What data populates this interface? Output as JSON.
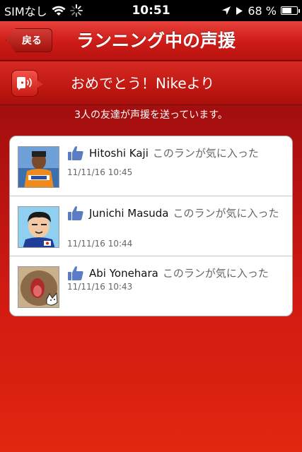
{
  "status_bar": {
    "carrier": "SIMなし",
    "time": "10:51",
    "battery": "68 %",
    "battery_level": 0.68
  },
  "nav": {
    "back_label": "戻る",
    "title": "ランニング中の声援"
  },
  "message": {
    "text": "おめでとう！Nikeより"
  },
  "summary": "3人の友達が声援を送っています。",
  "cheers": [
    {
      "name": "Hitoshi Kaji",
      "action": "このランが気に入った",
      "time": "11/11/16  10:45"
    },
    {
      "name": "Junichi Masuda",
      "action": "このランが気に入った",
      "time": "11/11/16  10:44"
    },
    {
      "name": "Abi Yonehara",
      "action": "このランが気に入った",
      "time": "11/11/16  10:43"
    }
  ],
  "colors": {
    "accent": "#cf1d18",
    "like_blue": "#5b7cc4"
  },
  "icons": [
    "wifi-icon",
    "spinner-icon",
    "location-icon",
    "play-icon",
    "battery-icon",
    "cheer-icon",
    "thumbs-up-icon"
  ]
}
